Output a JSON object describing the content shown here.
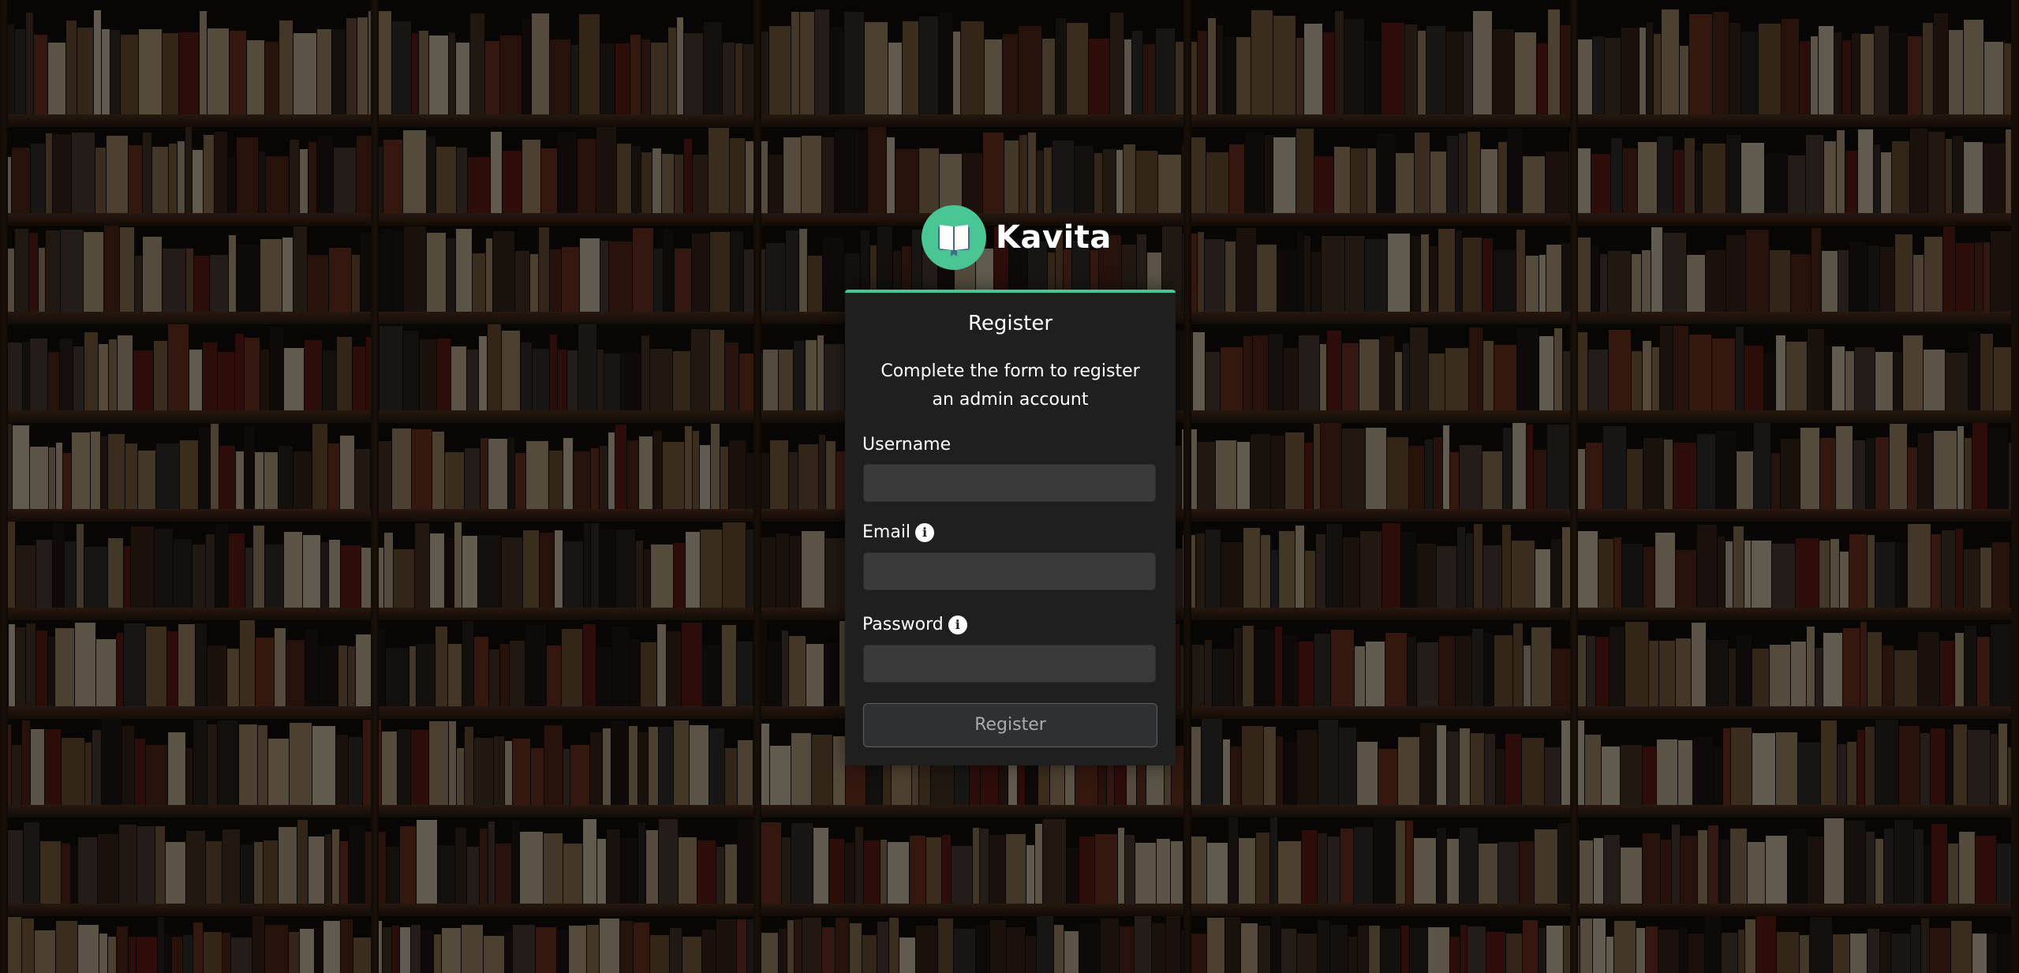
{
  "app": {
    "name": "Kavita",
    "logo_icon": "open-book-icon",
    "accent_color": "#4ac694"
  },
  "form": {
    "title": "Register",
    "subtitle": "Complete the form to register an admin account",
    "fields": [
      {
        "label": "Username",
        "value": "",
        "placeholder": "",
        "has_info_icon": false
      },
      {
        "label": "Email",
        "value": "",
        "placeholder": "",
        "has_info_icon": true,
        "info_icon": "info-circle-icon"
      },
      {
        "label": "Password",
        "value": "",
        "placeholder": "",
        "has_info_icon": true,
        "info_icon": "info-circle-icon"
      }
    ],
    "submit_label": "Register"
  },
  "background": {
    "description_icon": "bookshelf-background"
  }
}
